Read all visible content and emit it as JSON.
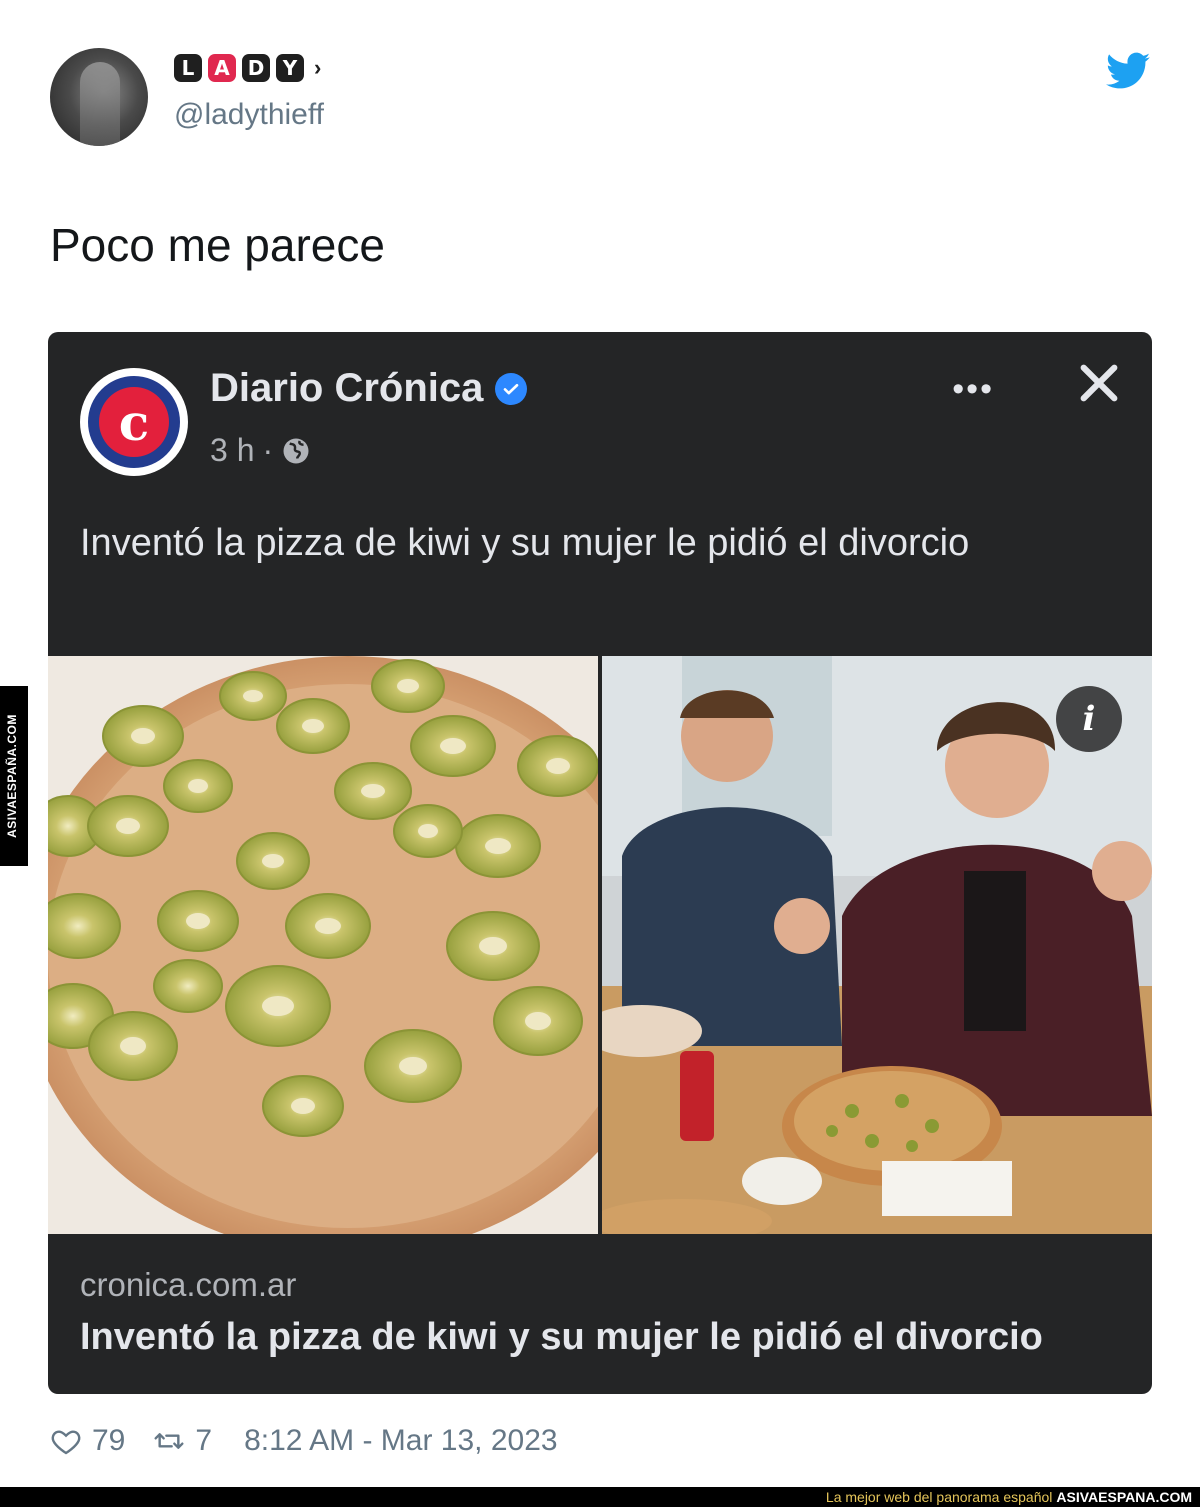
{
  "tweet": {
    "display_name_letters": [
      "L",
      "A",
      "D",
      "Y"
    ],
    "display_name_arrow": "›",
    "handle": "@ladythieff",
    "text": "Poco me parece"
  },
  "embedded_post": {
    "page_name": "Diario Crónica",
    "logo_letter": "c",
    "time": "3 h",
    "separator": "·",
    "more_label": "•••",
    "text": "Inventó la pizza de kiwi y su mujer le pidió el divorcio",
    "info_label": "i",
    "link": {
      "domain": "cronica.com.ar",
      "title": "Inventó la pizza de kiwi y su mujer le pidió el divorcio"
    }
  },
  "footer": {
    "likes": "79",
    "retweets": "7",
    "timestamp": "8:12 AM - Mar 13, 2023"
  },
  "watermark": {
    "side_text": "ASIVAESPAÑA.COM",
    "tagline": "La mejor web del panorama español",
    "brand": "ASIVAESPANA.COM"
  },
  "colors": {
    "twitter_blue": "#1da1f2",
    "card_bg": "#242526",
    "verified_blue": "#2d88ff",
    "logo_red": "#e3203c",
    "logo_navy": "#233c8f"
  }
}
